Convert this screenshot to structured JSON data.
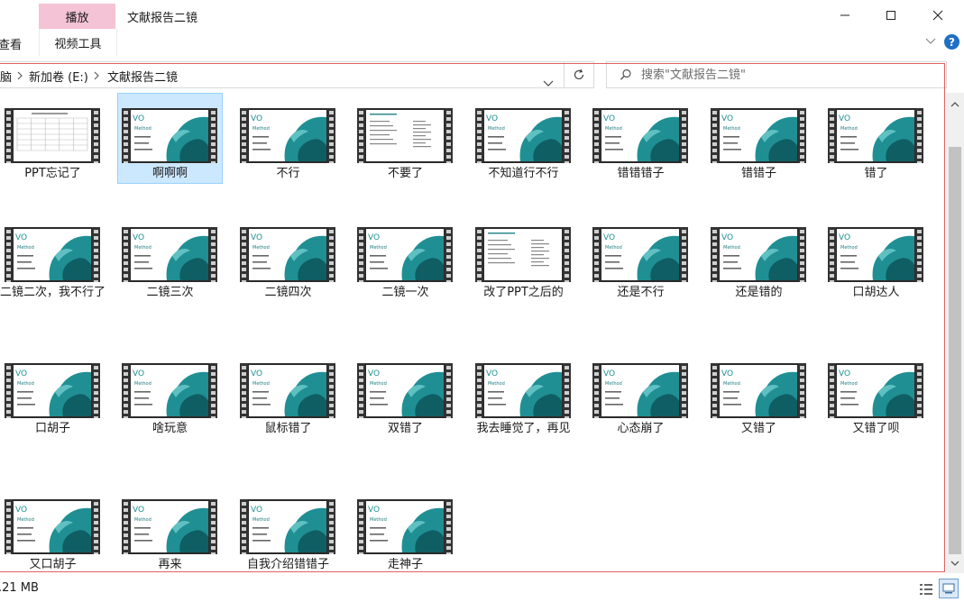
{
  "window": {
    "title": "文献报告二镜",
    "contextual_tab": "播放",
    "ribbon_tab_view": "查看",
    "ribbon_tab_video_tools": "视频工具",
    "help_glyph": "?"
  },
  "address": {
    "breadcrumbs": [
      "脑",
      "新加卷 (E:)",
      "文献报告二镜"
    ],
    "search_placeholder": "搜索\"文献报告二镜\""
  },
  "files": [
    {
      "name": "PPT忘记了",
      "thumb": "table"
    },
    {
      "name": "啊啊啊",
      "thumb": "teal",
      "selected": true
    },
    {
      "name": "不行",
      "thumb": "teal"
    },
    {
      "name": "不要了",
      "thumb": "doc"
    },
    {
      "name": "不知道行不行",
      "thumb": "teal"
    },
    {
      "name": "错错错子",
      "thumb": "teal"
    },
    {
      "name": "错错子",
      "thumb": "teal"
    },
    {
      "name": "错了",
      "thumb": "teal"
    },
    {
      "name": "二镜二次，我不行了",
      "thumb": "teal"
    },
    {
      "name": "二镜三次",
      "thumb": "teal"
    },
    {
      "name": "二镜四次",
      "thumb": "teal"
    },
    {
      "name": "二镜一次",
      "thumb": "teal"
    },
    {
      "name": "改了PPT之后的",
      "thumb": "doc"
    },
    {
      "name": "还是不行",
      "thumb": "teal"
    },
    {
      "name": "还是错的",
      "thumb": "teal"
    },
    {
      "name": "口胡达人",
      "thumb": "teal"
    },
    {
      "name": "口胡子",
      "thumb": "teal"
    },
    {
      "name": "啥玩意",
      "thumb": "teal"
    },
    {
      "name": "鼠标错了",
      "thumb": "teal"
    },
    {
      "name": "双错了",
      "thumb": "teal"
    },
    {
      "name": "我去睡觉了，再见",
      "thumb": "teal"
    },
    {
      "name": "心态崩了",
      "thumb": "teal"
    },
    {
      "name": "又错了",
      "thumb": "teal"
    },
    {
      "name": "又错了呗",
      "thumb": "teal"
    },
    {
      "name": "又口胡子",
      "thumb": "teal"
    },
    {
      "name": "再来",
      "thumb": "teal"
    },
    {
      "name": "自我介绍错错子",
      "thumb": "teal"
    },
    {
      "name": "走神子",
      "thumb": "teal"
    }
  ],
  "status": {
    "size_text": ".21 MB"
  },
  "colors": {
    "ribbon_contextual": "#f4c3d6",
    "selection_bg": "#cce8ff",
    "selection_border": "#99d1ff",
    "frame_red": "#e06060",
    "teal": "#1f8f94"
  }
}
